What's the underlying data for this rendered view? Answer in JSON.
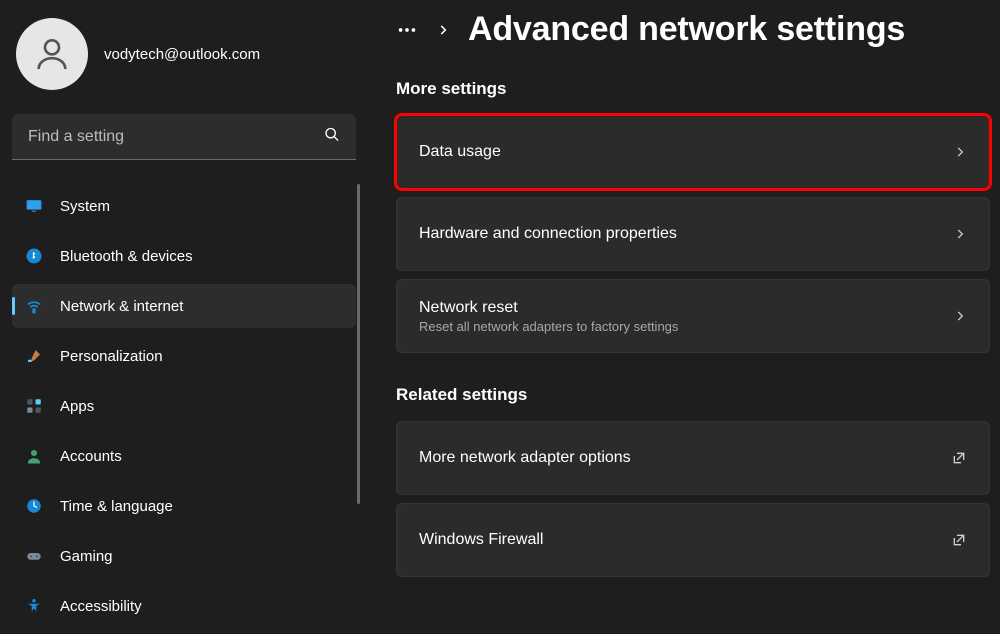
{
  "user": {
    "email": "vodytech@outlook.com"
  },
  "search": {
    "placeholder": "Find a setting"
  },
  "sidebar": {
    "items": [
      {
        "label": "System"
      },
      {
        "label": "Bluetooth & devices"
      },
      {
        "label": "Network & internet"
      },
      {
        "label": "Personalization"
      },
      {
        "label": "Apps"
      },
      {
        "label": "Accounts"
      },
      {
        "label": "Time & language"
      },
      {
        "label": "Gaming"
      },
      {
        "label": "Accessibility"
      }
    ]
  },
  "header": {
    "title": "Advanced network settings"
  },
  "sections": {
    "more": "More settings",
    "related": "Related settings"
  },
  "cards": {
    "data_usage": {
      "title": "Data usage"
    },
    "hw_props": {
      "title": "Hardware and connection properties"
    },
    "net_reset": {
      "title": "Network reset",
      "sub": "Reset all network adapters to factory settings"
    },
    "more_adapter": {
      "title": "More network adapter options"
    },
    "firewall": {
      "title": "Windows Firewall"
    }
  }
}
